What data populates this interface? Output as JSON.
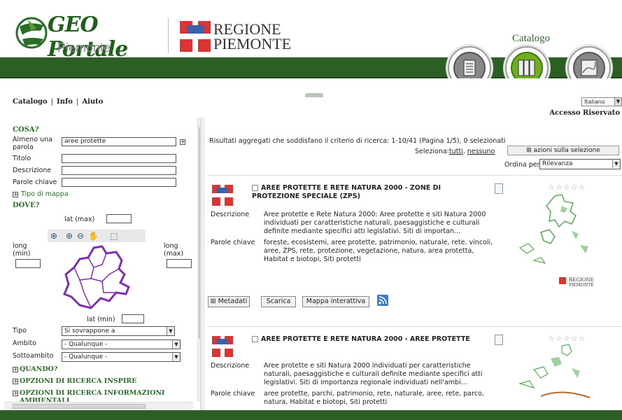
{
  "header": {
    "geo_title": "GEO Portale",
    "geo_subtitle": "Piemonte",
    "regione_line1": "REGIONE",
    "regione_line2": "PIEMONTE",
    "catalogo_label": "Catalogo",
    "brand_color": "#2b5f24",
    "accent_color": "#6fae1c",
    "nav_icons": [
      "document-icon",
      "catalog-books-icon",
      "map-icon"
    ]
  },
  "nav": {
    "links": [
      "Catalogo",
      "Info",
      "Aiuto"
    ],
    "language": "Italiano",
    "accesso": "Accesso Riservato"
  },
  "search": {
    "cosa_title": "COSA?",
    "almeno_label": "Almeno una parola",
    "almeno_value": "aree protette",
    "titolo_label": "Titolo",
    "descrizione_label": "Descrizione",
    "parole_label": "Parole chiave",
    "tipo_mappa": "Tipo di mappa",
    "dove_title": "DOVE?",
    "lat_max": "lat (max)",
    "long_min": "long (min)",
    "long_max": "long (max)",
    "lat_min": "lat (min)",
    "tipo_label": "Tipo",
    "tipo_value": "Si sovrappone a",
    "ambito_label": "Ambito",
    "ambito_value": "- Qualunque -",
    "sottoambito_label": "Sottoambito",
    "sottoambito_value": "- Qualunque -",
    "quando": "QUANDO?",
    "opz_inspire": "OPZIONI DI RICERCA INSPIRE",
    "opz_ambientali": "OPZIONI DI RICERCA INFORMAZIONI AMBIENTALI"
  },
  "results": {
    "summary": "Risultati aggregati che soddisfano il criterio di ricerca:   1-10/41   (Pagina 1/5),   0 selezionati",
    "seleziona_label": "Seleziona:",
    "tutti": "tutti",
    "nessuno": "nessuno",
    "azioni": "azioni sulla selezione",
    "ordina_label": "Ordina per",
    "ordina_value": "Rilevanza",
    "desc_label": "Descrizione",
    "parole_label": "Parole chiave",
    "items": [
      {
        "title": "AREE PROTETTE E RETE NATURA 2000 - ZONE DI PROTEZIONE SPECIALE (ZPS)",
        "description": "Aree protette e Rete Natura 2000: Aree protette e siti Natura 2000 individuati per caratteristiche naturali, paesaggistiche e culturali definite mediante specifici atti legislativi. Siti di importan...",
        "keywords": "foreste, ecosistemi, aree protette, patrimonio, naturale, rete, vincoli, aree, ZPS, rete, protezione, vegetazione, natura, area protetta, Habitat e biotopi, Siti protetti",
        "stars": "☆☆☆☆☆",
        "thumb_logo_1": "REGIONE",
        "thumb_logo_2": "PIEMONTE"
      },
      {
        "title": "AREE PROTETTE E RETE NATURA 2000 - AREE PROTETTE",
        "description": "Aree protette e siti Natura 2000 individuati per caratteristiche naturali, paesaggistiche e culturali definite mediante specifici atti legislativi. Siti di importanza regionale individuati nell'ambi...",
        "keywords": "aree protette, parchi, patrimonio, rete, naturale, aree, rete, parco, natura, Habitat e biotopi, Siti protetti",
        "stars": "☆☆☆☆☆"
      }
    ],
    "btn_metadati": "Metadati",
    "btn_scarica": "Scarica",
    "btn_mappa": "Mappa interattiva"
  }
}
